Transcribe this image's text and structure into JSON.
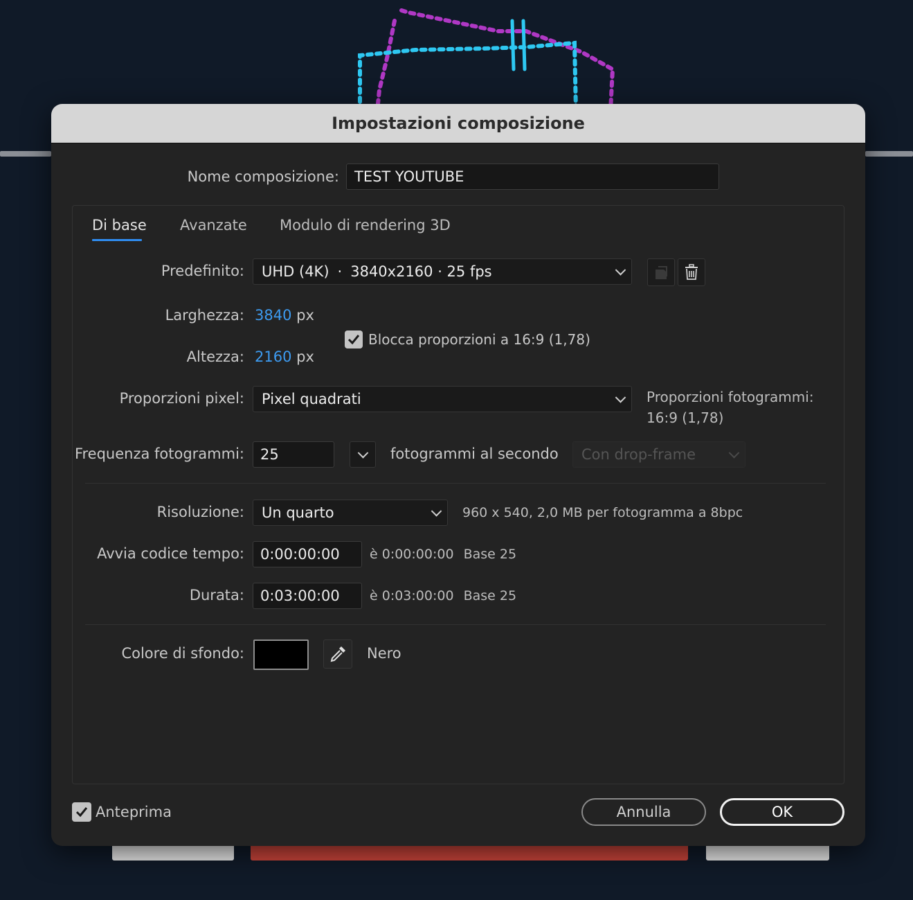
{
  "dialog": {
    "title": "Impostazioni composizione",
    "name_label": "Nome composizione:",
    "name_value": "TEST YOUTUBE"
  },
  "tabs": [
    {
      "label": "Di base",
      "active": true
    },
    {
      "label": "Avanzate",
      "active": false
    },
    {
      "label": "Modulo di rendering 3D",
      "active": false
    }
  ],
  "preset": {
    "label": "Predefinito:",
    "value_name": "UHD (4K)",
    "value_sep": "·",
    "value_detail": "3840x2160 · 25 fps",
    "save_icon": "save-preset-icon",
    "delete_icon": "trash-icon"
  },
  "size": {
    "width_label": "Larghezza:",
    "width_value": "3840",
    "height_label": "Altezza:",
    "height_value": "2160",
    "unit": "px",
    "lock_checked": true,
    "lock_label": "Blocca proporzioni a 16:9 (1,78)"
  },
  "pixel_aspect": {
    "label": "Proporzioni pixel:",
    "value": "Pixel quadrati",
    "frame_aspect_label": "Proporzioni fotogrammi:",
    "frame_aspect_value": "16:9 (1,78)"
  },
  "frame_rate": {
    "label": "Frequenza fotogrammi:",
    "value": "25",
    "unit": "fotogrammi al secondo",
    "drop_frame": "Con drop-frame"
  },
  "resolution": {
    "label": "Risoluzione:",
    "value": "Un quarto",
    "info": "960 x 540, 2,0 MB per fotogramma a 8bpc"
  },
  "start_timecode": {
    "label": "Avvia codice tempo:",
    "value": "0:00:00:00",
    "equiv": "è 0:00:00:00",
    "base": "Base 25"
  },
  "duration": {
    "label": "Durata:",
    "value": "0:03:00:00",
    "equiv": "è 0:03:00:00",
    "base": "Base 25"
  },
  "background": {
    "label": "Colore di sfondo:",
    "color": "#000000",
    "color_name": "Nero",
    "eyedropper_icon": "eyedropper-icon"
  },
  "footer": {
    "preview_checked": true,
    "preview_label": "Anteprima",
    "cancel_label": "Annulla",
    "ok_label": "OK"
  },
  "colors": {
    "accent": "#2f8cf0",
    "value_blue": "#3d9bf0",
    "dialog_bg": "#232323",
    "titlebar_bg": "#d6d6d6"
  }
}
